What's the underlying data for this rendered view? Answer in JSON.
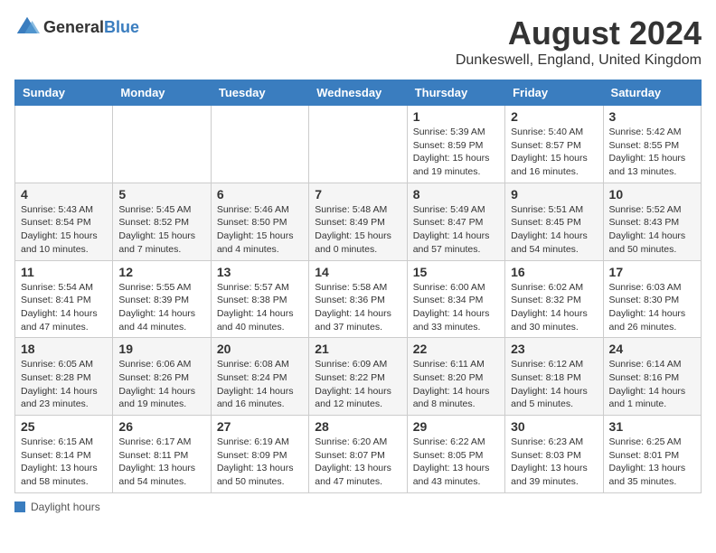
{
  "logo": {
    "general": "General",
    "blue": "Blue"
  },
  "title": "August 2024",
  "subtitle": "Dunkeswell, England, United Kingdom",
  "days_of_week": [
    "Sunday",
    "Monday",
    "Tuesday",
    "Wednesday",
    "Thursday",
    "Friday",
    "Saturday"
  ],
  "footer": {
    "label": "Daylight hours"
  },
  "weeks": [
    [
      {
        "day": "",
        "info": ""
      },
      {
        "day": "",
        "info": ""
      },
      {
        "day": "",
        "info": ""
      },
      {
        "day": "",
        "info": ""
      },
      {
        "day": "1",
        "info": "Sunrise: 5:39 AM\nSunset: 8:59 PM\nDaylight: 15 hours\nand 19 minutes."
      },
      {
        "day": "2",
        "info": "Sunrise: 5:40 AM\nSunset: 8:57 PM\nDaylight: 15 hours\nand 16 minutes."
      },
      {
        "day": "3",
        "info": "Sunrise: 5:42 AM\nSunset: 8:55 PM\nDaylight: 15 hours\nand 13 minutes."
      }
    ],
    [
      {
        "day": "4",
        "info": "Sunrise: 5:43 AM\nSunset: 8:54 PM\nDaylight: 15 hours\nand 10 minutes."
      },
      {
        "day": "5",
        "info": "Sunrise: 5:45 AM\nSunset: 8:52 PM\nDaylight: 15 hours\nand 7 minutes."
      },
      {
        "day": "6",
        "info": "Sunrise: 5:46 AM\nSunset: 8:50 PM\nDaylight: 15 hours\nand 4 minutes."
      },
      {
        "day": "7",
        "info": "Sunrise: 5:48 AM\nSunset: 8:49 PM\nDaylight: 15 hours\nand 0 minutes."
      },
      {
        "day": "8",
        "info": "Sunrise: 5:49 AM\nSunset: 8:47 PM\nDaylight: 14 hours\nand 57 minutes."
      },
      {
        "day": "9",
        "info": "Sunrise: 5:51 AM\nSunset: 8:45 PM\nDaylight: 14 hours\nand 54 minutes."
      },
      {
        "day": "10",
        "info": "Sunrise: 5:52 AM\nSunset: 8:43 PM\nDaylight: 14 hours\nand 50 minutes."
      }
    ],
    [
      {
        "day": "11",
        "info": "Sunrise: 5:54 AM\nSunset: 8:41 PM\nDaylight: 14 hours\nand 47 minutes."
      },
      {
        "day": "12",
        "info": "Sunrise: 5:55 AM\nSunset: 8:39 PM\nDaylight: 14 hours\nand 44 minutes."
      },
      {
        "day": "13",
        "info": "Sunrise: 5:57 AM\nSunset: 8:38 PM\nDaylight: 14 hours\nand 40 minutes."
      },
      {
        "day": "14",
        "info": "Sunrise: 5:58 AM\nSunset: 8:36 PM\nDaylight: 14 hours\nand 37 minutes."
      },
      {
        "day": "15",
        "info": "Sunrise: 6:00 AM\nSunset: 8:34 PM\nDaylight: 14 hours\nand 33 minutes."
      },
      {
        "day": "16",
        "info": "Sunrise: 6:02 AM\nSunset: 8:32 PM\nDaylight: 14 hours\nand 30 minutes."
      },
      {
        "day": "17",
        "info": "Sunrise: 6:03 AM\nSunset: 8:30 PM\nDaylight: 14 hours\nand 26 minutes."
      }
    ],
    [
      {
        "day": "18",
        "info": "Sunrise: 6:05 AM\nSunset: 8:28 PM\nDaylight: 14 hours\nand 23 minutes."
      },
      {
        "day": "19",
        "info": "Sunrise: 6:06 AM\nSunset: 8:26 PM\nDaylight: 14 hours\nand 19 minutes."
      },
      {
        "day": "20",
        "info": "Sunrise: 6:08 AM\nSunset: 8:24 PM\nDaylight: 14 hours\nand 16 minutes."
      },
      {
        "day": "21",
        "info": "Sunrise: 6:09 AM\nSunset: 8:22 PM\nDaylight: 14 hours\nand 12 minutes."
      },
      {
        "day": "22",
        "info": "Sunrise: 6:11 AM\nSunset: 8:20 PM\nDaylight: 14 hours\nand 8 minutes."
      },
      {
        "day": "23",
        "info": "Sunrise: 6:12 AM\nSunset: 8:18 PM\nDaylight: 14 hours\nand 5 minutes."
      },
      {
        "day": "24",
        "info": "Sunrise: 6:14 AM\nSunset: 8:16 PM\nDaylight: 14 hours\nand 1 minute."
      }
    ],
    [
      {
        "day": "25",
        "info": "Sunrise: 6:15 AM\nSunset: 8:14 PM\nDaylight: 13 hours\nand 58 minutes."
      },
      {
        "day": "26",
        "info": "Sunrise: 6:17 AM\nSunset: 8:11 PM\nDaylight: 13 hours\nand 54 minutes."
      },
      {
        "day": "27",
        "info": "Sunrise: 6:19 AM\nSunset: 8:09 PM\nDaylight: 13 hours\nand 50 minutes."
      },
      {
        "day": "28",
        "info": "Sunrise: 6:20 AM\nSunset: 8:07 PM\nDaylight: 13 hours\nand 47 minutes."
      },
      {
        "day": "29",
        "info": "Sunrise: 6:22 AM\nSunset: 8:05 PM\nDaylight: 13 hours\nand 43 minutes."
      },
      {
        "day": "30",
        "info": "Sunrise: 6:23 AM\nSunset: 8:03 PM\nDaylight: 13 hours\nand 39 minutes."
      },
      {
        "day": "31",
        "info": "Sunrise: 6:25 AM\nSunset: 8:01 PM\nDaylight: 13 hours\nand 35 minutes."
      }
    ]
  ]
}
